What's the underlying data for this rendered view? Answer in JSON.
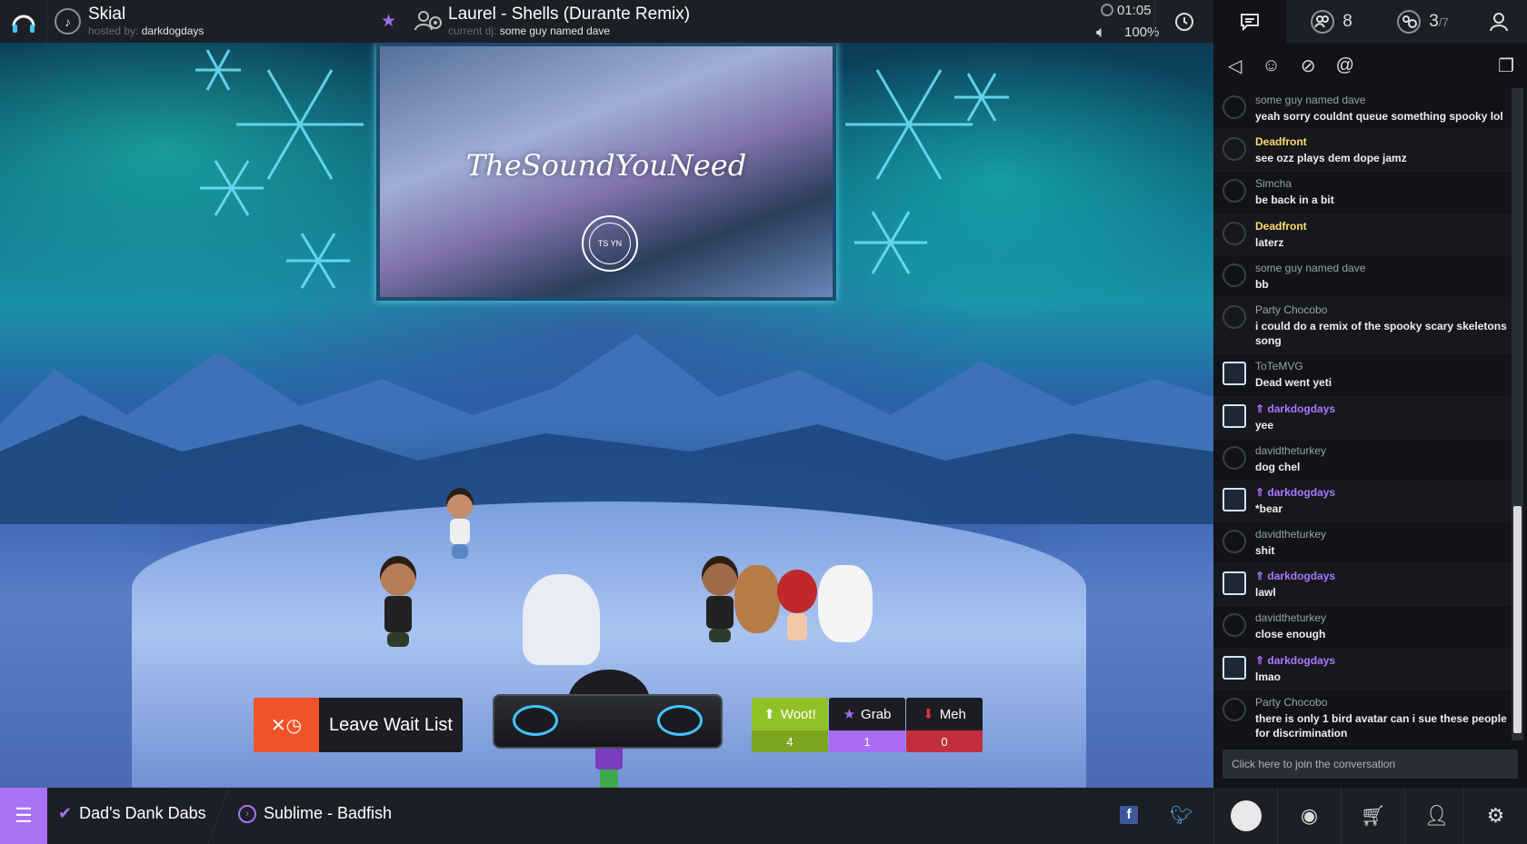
{
  "room": {
    "title": "Skial",
    "hosted_by_label": "hosted by:",
    "host": "darkdogdays"
  },
  "now_playing": {
    "song": "Laurel - Shells (Durante Remix)",
    "dj_label": "current dj:",
    "dj": "some guy named dave",
    "time_remaining": "01:05",
    "volume": "100%"
  },
  "tabs": {
    "audience_count": "8",
    "waitlist_pos": "3",
    "waitlist_total": "/7"
  },
  "screen": {
    "title": "TheSoundYouNeed",
    "seal_text": "TS YN"
  },
  "actions": {
    "leave_wait_list": "Leave Wait List"
  },
  "votes": {
    "woot": {
      "label": "Woot!",
      "count": "4",
      "color": "#90c227"
    },
    "grab": {
      "label": "Grab",
      "count": "1",
      "color": "#a96cf3"
    },
    "meh": {
      "label": "Meh",
      "count": "0",
      "color": "#c42e3b"
    }
  },
  "chat": {
    "messages": [
      {
        "user": "some guy named dave",
        "text": "yeah sorry couldnt queue something spooky lol",
        "role": ""
      },
      {
        "user": "Deadfront",
        "text": "see ozz plays dem dope jamz",
        "role": "gold"
      },
      {
        "user": "Simcha",
        "text": "be back in a bit",
        "role": ""
      },
      {
        "user": "Deadfront",
        "text": "laterz",
        "role": "gold"
      },
      {
        "user": "some guy named dave",
        "text": "bb",
        "role": ""
      },
      {
        "user": "Party Chocobo",
        "text": "i could do a remix of the spooky scary skeletons song",
        "role": ""
      },
      {
        "user": "ToTeMVG",
        "text": "Dead went yeti",
        "role": "staff"
      },
      {
        "user": "darkdogdays",
        "text": "yee",
        "role": "host"
      },
      {
        "user": "davidtheturkey",
        "text": "dog chel",
        "role": ""
      },
      {
        "user": "darkdogdays",
        "text": "*bear",
        "role": "host"
      },
      {
        "user": "davidtheturkey",
        "text": "shit",
        "role": ""
      },
      {
        "user": "darkdogdays",
        "text": "lawl",
        "role": "host"
      },
      {
        "user": "davidtheturkey",
        "text": "close enough",
        "role": ""
      },
      {
        "user": "darkdogdays",
        "text": "lmao",
        "role": "host"
      },
      {
        "user": "Party Chocobo",
        "text": "there is only 1 bird avatar can i sue these people for discrimination",
        "role": ""
      }
    ],
    "input_placeholder": "Click here to join the conversation"
  },
  "bottom": {
    "playlist": "Dad's Dank Dabs",
    "next_song": "Sublime - Badfish"
  },
  "colors": {
    "accent": "#a972f5",
    "leave": "#f0542b"
  }
}
